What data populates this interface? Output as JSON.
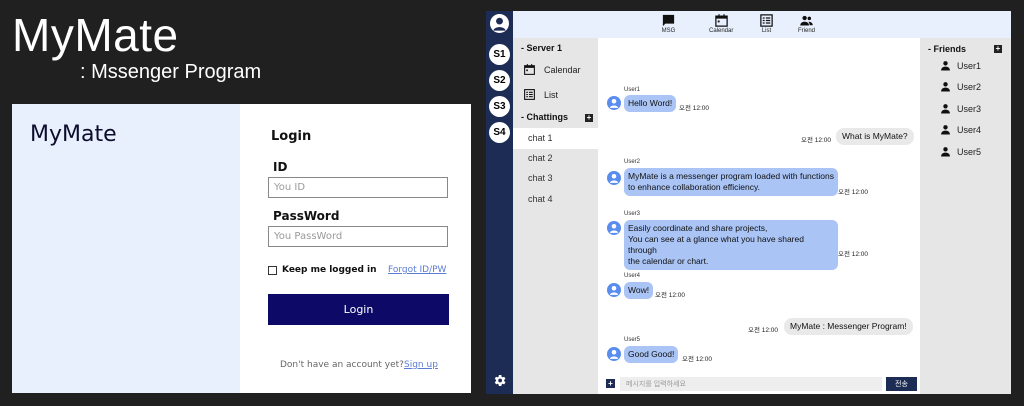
{
  "banner": {
    "title": "MyMate",
    "subtitle": ": Mssenger Program"
  },
  "login": {
    "logo": "MyMate",
    "title": "Login",
    "id_label": "ID",
    "id_placeholder": "You ID",
    "pw_label": "PassWord",
    "pw_placeholder": "You PassWord",
    "remember_label": "Keep me logged in",
    "remember_checked": false,
    "forgot_label": "Forgot ID/PW",
    "login_button": "Login",
    "no_account": "Don't have an account yet?",
    "signup_label": "Sign up",
    "colors": {
      "accent": "#0c0a66",
      "panel": "#e8f0fe",
      "link": "#5b7bd6"
    }
  },
  "messenger": {
    "servers": [
      "S1",
      "S2",
      "S3",
      "S4"
    ],
    "topbar": [
      {
        "label": "MSG",
        "icon": "message-icon"
      },
      {
        "label": "Calendar",
        "icon": "calendar-icon"
      },
      {
        "label": "List",
        "icon": "list-icon"
      },
      {
        "label": "Friend",
        "icon": "friends-icon"
      }
    ],
    "channels": {
      "server_heading": "- Server 1",
      "tools": [
        {
          "label": "Calendar",
          "icon": "calendar-icon"
        },
        {
          "label": "List",
          "icon": "list-icon"
        }
      ],
      "chattings_heading": "- Chattings",
      "chats": [
        "chat 1",
        "chat 2",
        "chat 3",
        "chat 4"
      ],
      "active_chat": "chat 1"
    },
    "messages": [
      {
        "side": "left",
        "user": "User1",
        "text": "Hello Word!",
        "time": "오전 12:00"
      },
      {
        "side": "right",
        "text": "What is MyMate?",
        "time": "오전 12:00"
      },
      {
        "side": "left",
        "user": "User2",
        "lines": [
          "MyMate is a messenger program loaded with functions",
          "to enhance collaboration efficiency."
        ],
        "time": "오전 12:00"
      },
      {
        "side": "left",
        "user": "User3",
        "lines": [
          "Easily coordinate and share projects,",
          "You can see at a glance what you have shared through",
          "the calendar or chart."
        ],
        "time": "오전 12:00"
      },
      {
        "side": "left",
        "user": "User4",
        "text": "Wow!",
        "time": "오전 12:00"
      },
      {
        "side": "right",
        "text": "MyMate : Messenger Program!",
        "time": "오전 12:00"
      },
      {
        "side": "left",
        "user": "User5",
        "text": "Good Good!",
        "time": "오전 12:00"
      }
    ],
    "input": {
      "placeholder": "메시지를 입력하세요",
      "send_label": "전송"
    },
    "friends": {
      "heading": "- Friends",
      "list": [
        "User1",
        "User2",
        "User3",
        "User4",
        "User5"
      ]
    },
    "colors": {
      "rail": "#1c2c54",
      "bubble": "#a9c4f5",
      "topbar": "#e8f0fe"
    }
  }
}
